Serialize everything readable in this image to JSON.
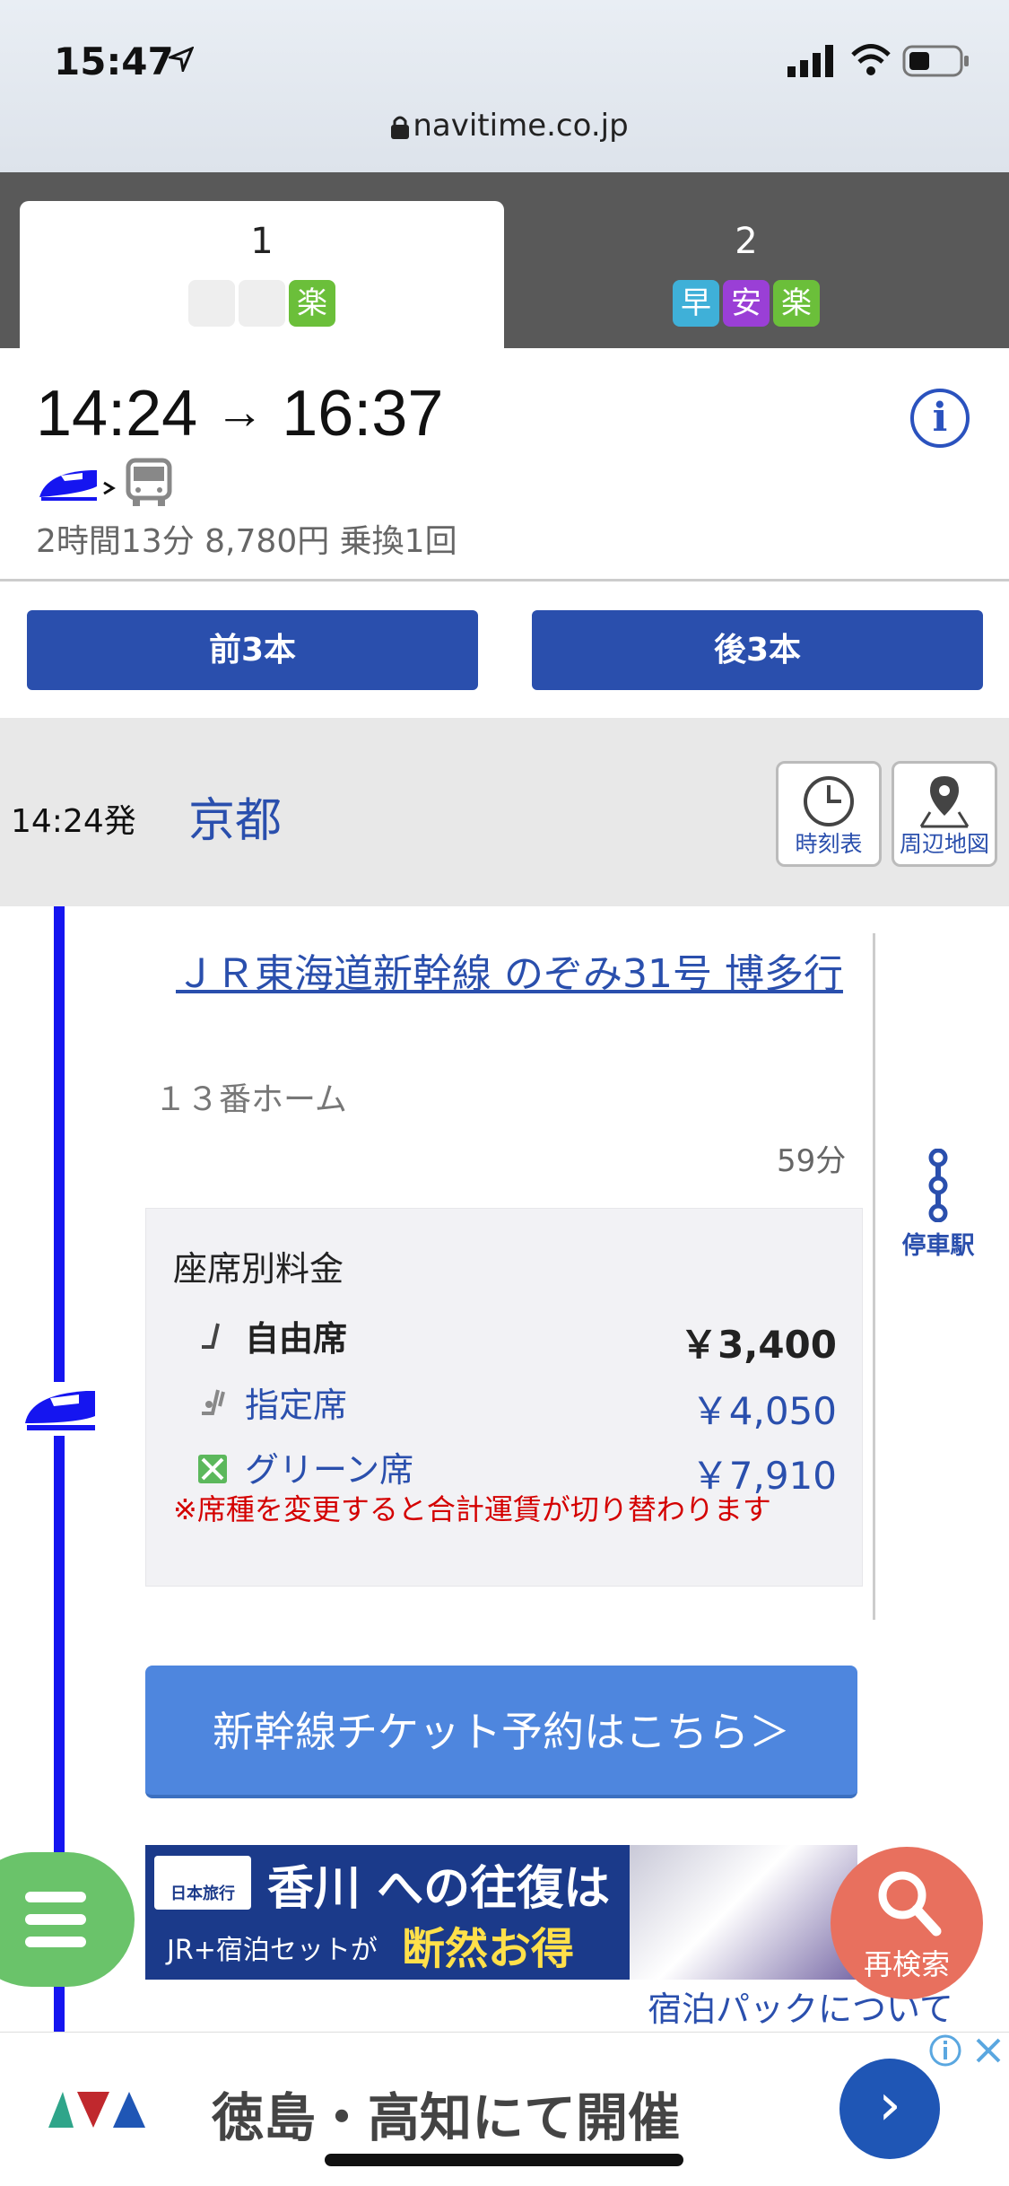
{
  "status_bar": {
    "time": "15:47",
    "url": "navitime.co.jp"
  },
  "tabs": [
    {
      "number": "1",
      "badges": [
        "",
        "",
        "楽"
      ],
      "active": true
    },
    {
      "number": "2",
      "badges": [
        "早",
        "安",
        "楽"
      ],
      "active": false
    }
  ],
  "summary": {
    "depart": "14:24",
    "arrow": "→",
    "arrive": "16:37",
    "meta": "2時間13分 8,780円 乗換1回"
  },
  "nav": {
    "prev_label": "前3本",
    "next_label": "後3本"
  },
  "departure": {
    "time": "14:24発",
    "station": "京都",
    "timetable_label": "時刻表",
    "map_label": "周辺地図"
  },
  "leg": {
    "train_name": "ＪＲ東海道新幹線 のぞみ31号 博多行",
    "platform": "１３番ホーム",
    "duration": "59分",
    "stop_stations_label": "停車駅"
  },
  "fares": {
    "title": "座席別料金",
    "rows": [
      {
        "name": "自由席",
        "price": "￥3,400",
        "selected": true
      },
      {
        "name": "指定席",
        "price": "￥4,050",
        "selected": false
      },
      {
        "name": "グリーン席",
        "price": "￥7,910",
        "selected": false
      }
    ],
    "note": "※席種を変更すると合計運賃が切り替わります"
  },
  "ticket_button": "新幹線チケット予約はこちら＞",
  "banner": {
    "logo": "日本旅行",
    "headline": "香川 への往復は",
    "sub": "JR+宿泊セットが",
    "emphasis": "断然お得"
  },
  "package_link": "宿泊パックについて",
  "research_label": "再検索",
  "bottom_ad": {
    "text": "徳島・高知にて開催",
    "arrow": "›"
  },
  "colors": {
    "primary": "#2a4fad",
    "route_line": "#1515f0",
    "badge_green": "#6bbf3a",
    "badge_blue": "#3fb0d8",
    "badge_purple": "#9a3fd6",
    "note_red": "#d40000",
    "menu_green": "#6ac36a",
    "search_coral": "#e8705e"
  }
}
